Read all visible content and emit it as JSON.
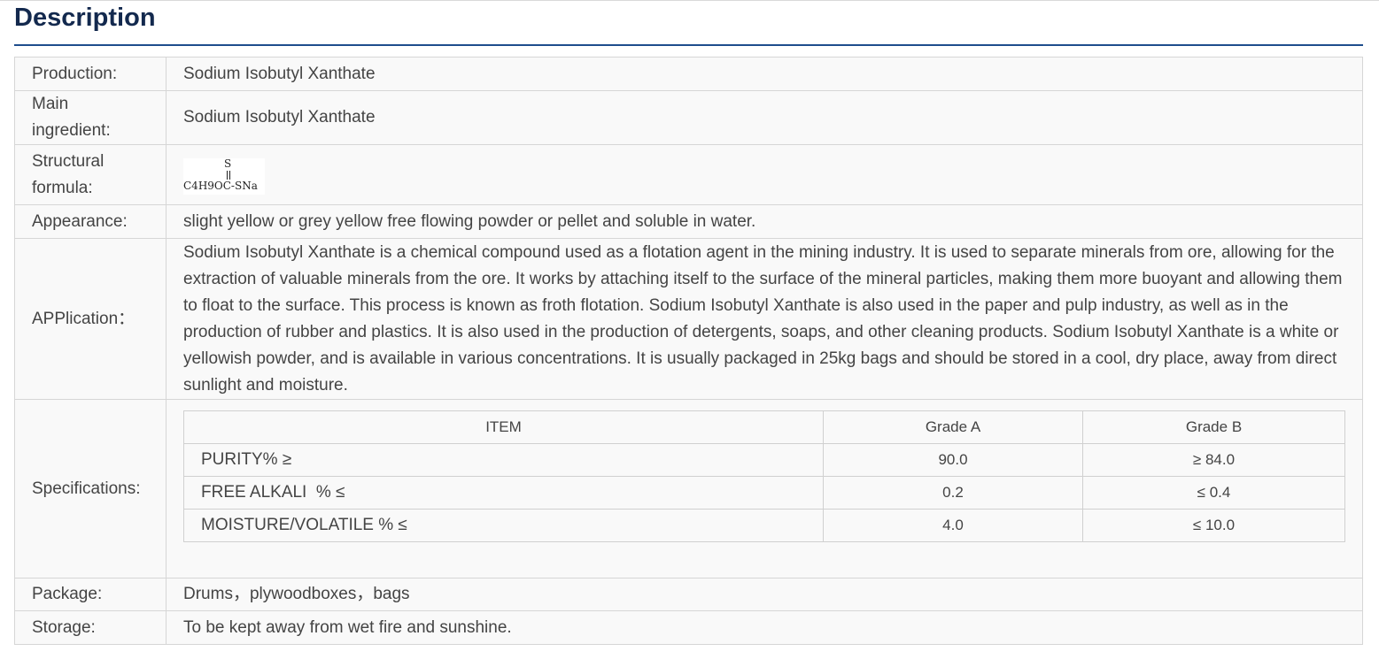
{
  "header": {
    "title": "Description"
  },
  "rows": {
    "production": {
      "label": "Production:",
      "value": "Sodium Isobutyl Xanthate"
    },
    "main_ingredient": {
      "label_line1": "Main",
      "label_line2": "ingredient:",
      "value": "Sodium Isobutyl Xanthate"
    },
    "structural_formula": {
      "label_line1": "Structural",
      "label_line2": "formula:",
      "formula_top": "S",
      "formula_main": "C4H9OC-SNa"
    },
    "appearance": {
      "label": "Appearance:",
      "value": "slight yellow or grey yellow free flowing powder or pellet and soluble in water."
    },
    "application": {
      "label": "APPlication：",
      "value": "Sodium Isobutyl Xanthate is a chemical compound used as a flotation agent in the mining industry. It is used to separate minerals from ore, allowing for the extraction of valuable minerals from the ore. It works by attaching itself to the surface of the mineral particles, making them more buoyant and allowing them to float to the surface. This process is known as froth flotation. Sodium Isobutyl Xanthate is also used in the paper and pulp industry, as well as in the production of rubber and plastics. It is also used in the production of detergents, soaps, and other cleaning products. Sodium Isobutyl Xanthate is a white or yellowish powder, and is available in various concentrations. It is usually packaged in 25kg bags and should be stored in a cool, dry place, away from direct sunlight and moisture."
    },
    "specifications": {
      "label": "Specifications:",
      "headers": [
        "ITEM",
        "Grade A",
        "Grade B"
      ],
      "items": [
        {
          "item": "PURITY% ≥",
          "grade_a": "90.0",
          "grade_b": "≥ 84.0"
        },
        {
          "item": "FREE ALKALI  % ≤",
          "grade_a": "0.2",
          "grade_b": "≤ 0.4"
        },
        {
          "item": "MOISTURE/VOLATILE % ≤",
          "grade_a": "4.0",
          "grade_b": "≤ 10.0"
        }
      ]
    },
    "package": {
      "label": "Package:",
      "value": "Drums，plywoodboxes，bags"
    },
    "storage": {
      "label": "Storage:",
      "value": "To be kept away from wet fire and sunshine."
    }
  }
}
